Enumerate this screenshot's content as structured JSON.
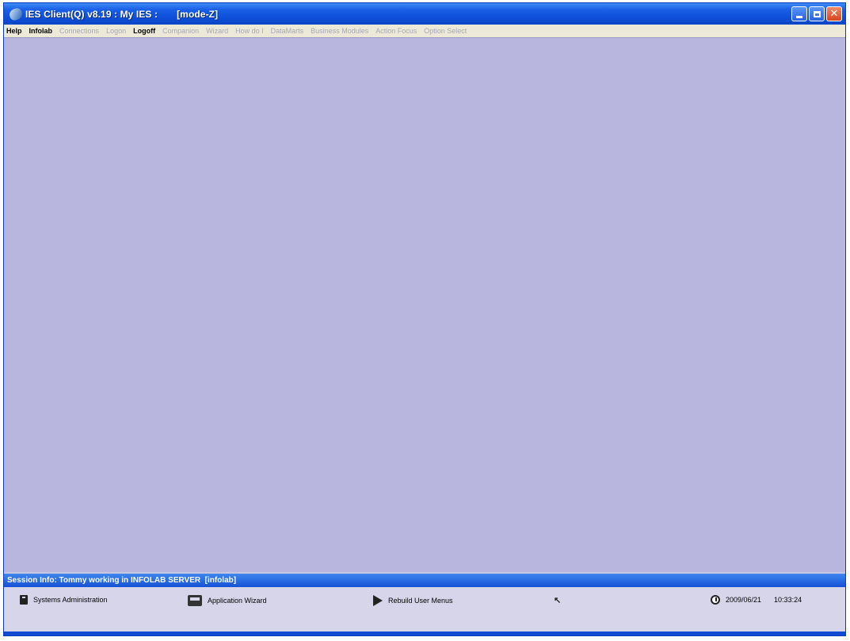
{
  "window": {
    "title": "IES Client(Q) v8.19 : My IES :       [mode-Z]",
    "controls": {
      "minimize": "minimize-icon",
      "maximize": "maximize-icon",
      "close": "close-icon"
    }
  },
  "menu": {
    "items": [
      {
        "label": "Help",
        "enabled": true
      },
      {
        "label": "Infolab",
        "enabled": true
      },
      {
        "label": "Connections",
        "enabled": false
      },
      {
        "label": "Logon",
        "enabled": false
      },
      {
        "label": "Logoff",
        "enabled": true
      },
      {
        "label": "Companion",
        "enabled": false
      },
      {
        "label": "Wizard",
        "enabled": false
      },
      {
        "label": "How do I",
        "enabled": false
      },
      {
        "label": "DataMarts",
        "enabled": false
      },
      {
        "label": "Business Modules",
        "enabled": false
      },
      {
        "label": "Action Focus",
        "enabled": false
      },
      {
        "label": "Option Select",
        "enabled": false
      }
    ]
  },
  "session": {
    "info": "Session Info: Tommy working in INFOLAB SERVER  [infolab]"
  },
  "taskbar": {
    "systems_admin": "Systems Administration",
    "app_wizard": "Application Wizard",
    "rebuild_menus": "Rebuild User Menus",
    "small_icon_glyph": "↖",
    "date": "2009/06/21",
    "time": "10:33:24"
  },
  "colors": {
    "workspace": "#b8b5df",
    "titlebar": "#0d4fd8",
    "session_bar": "#1551d6"
  }
}
